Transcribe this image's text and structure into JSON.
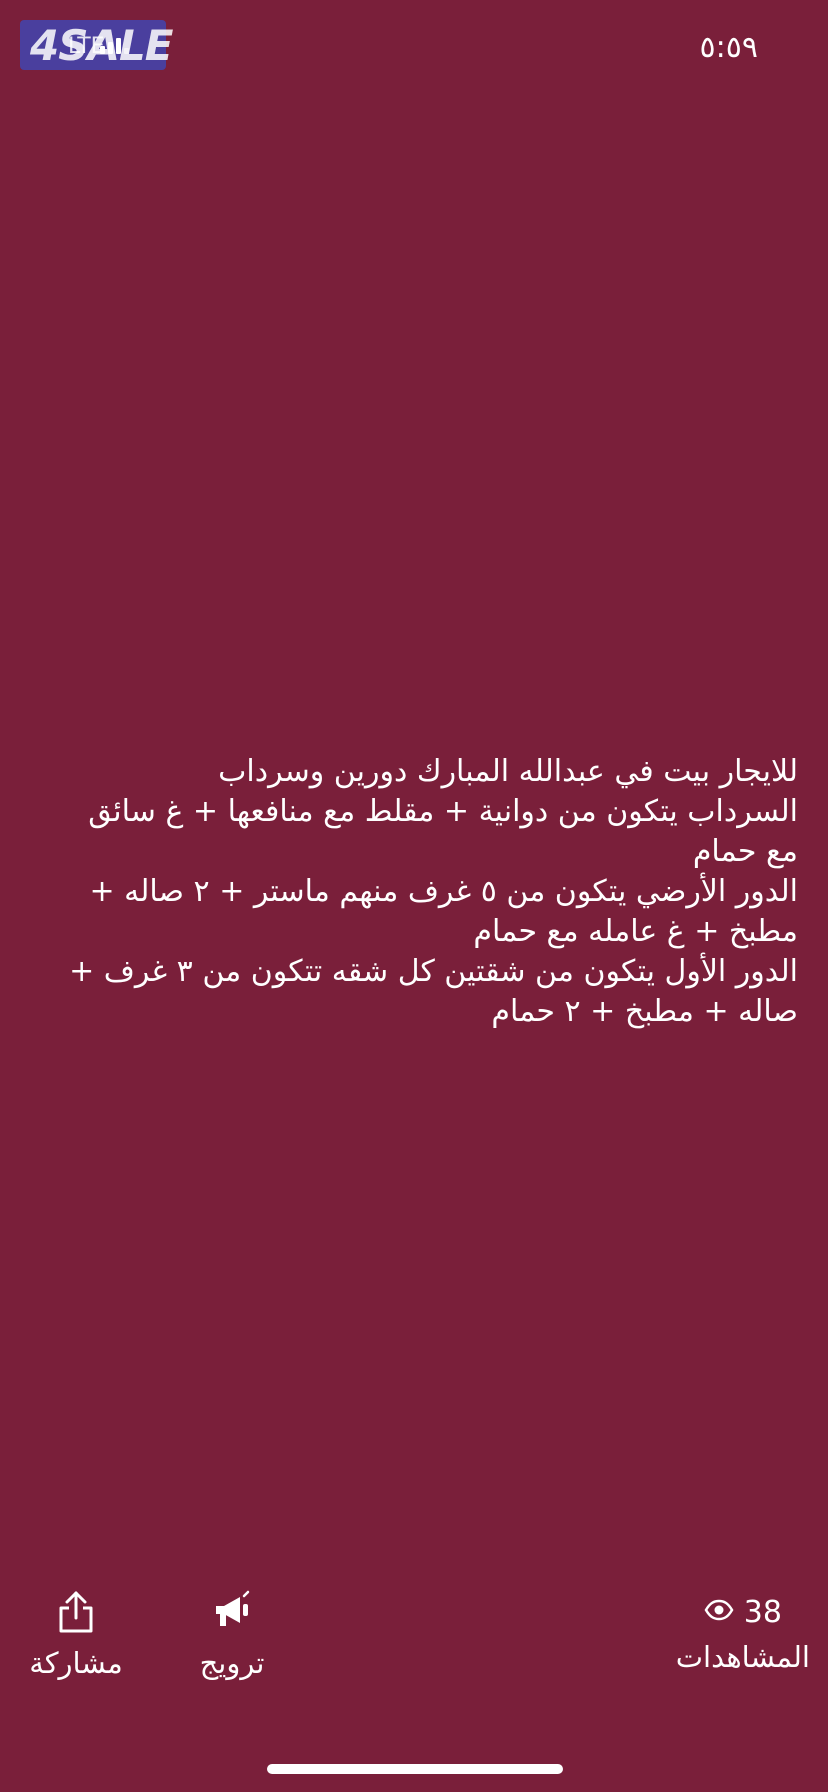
{
  "status_bar": {
    "logo_text": "4SALE",
    "carrier": "LTE",
    "time": "٥:٥٩"
  },
  "post": {
    "lines": [
      "للايجار بيت في عبدالله المبارك دورين وسرداب",
      "السرداب يتكون من دوانية + مقلط مع منافعها + غ سائق",
      "مع حمام",
      "الدور الأرضي يتكون من ٥ غرف منهم ماستر + ٢ صاله +",
      "مطبخ + غ عامله مع حمام",
      "الدور الأول يتكون من شقتين  كل شقه تتكون من ٣ غرف +",
      "صاله + مطبخ + ٢ حمام"
    ]
  },
  "footer": {
    "share_label": "مشاركة",
    "share_icon": "share-icon",
    "promote_label": "ترويج",
    "promote_icon": "megaphone-icon",
    "views_count": "38",
    "views_label": "المشاهدات",
    "views_icon": "eye-icon"
  },
  "colors": {
    "background": "#7a1f3a",
    "text": "#ffffff",
    "logo_bg": "#4a3f9e"
  }
}
